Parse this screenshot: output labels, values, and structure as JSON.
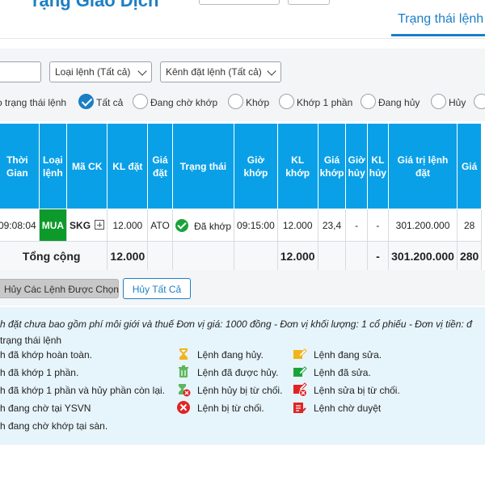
{
  "header": {
    "title_fragment": "rạng Giao Dịch",
    "status_tab": "Trạng thái lệnh"
  },
  "filters": {
    "order_type": "Loại lệnh (Tất cả)",
    "channel": "Kênh đặt lệnh (Tất cả)",
    "status_label": "o trạng thái lệnh",
    "status_options": [
      {
        "label": "Tất cả",
        "checked": true
      },
      {
        "label": "Đang chờ khớp",
        "checked": false
      },
      {
        "label": "Khớp",
        "checked": false
      },
      {
        "label": "Khớp 1 phần",
        "checked": false
      },
      {
        "label": "Đang hủy",
        "checked": false
      },
      {
        "label": "Hủy",
        "checked": false
      },
      {
        "label": "",
        "checked": false
      }
    ]
  },
  "table": {
    "headers": [
      "Thời Gian",
      "Loại lệnh",
      "Mã CK",
      "KL đặt",
      "Giá đặt",
      "Trạng thái",
      "Giờ khớp",
      "KL khớp",
      "Giá khớp",
      "Giờ hủy",
      "KL hủy",
      "Giá trị lệnh đặt",
      "Giá"
    ],
    "row": {
      "time": "09:08:04",
      "side": "MUA",
      "symbol": "SKG",
      "qty": "12.000",
      "price": "ATO",
      "status": "Đã khớp",
      "match_time": "09:15:00",
      "match_qty": "12.000",
      "match_price": "23,4",
      "cancel_time": "-",
      "cancel_qty": "-",
      "order_value": "301.200.000",
      "last_frag": "28"
    },
    "total": {
      "label": "Tổng cộng",
      "qty": "12.000",
      "match_qty": "12.000",
      "cancel_qty": "-",
      "order_value": "301.200.000",
      "last_frag": "280"
    }
  },
  "actions": {
    "cancel_selected": "Hủy Các Lệnh Được Chọn",
    "cancel_all": "Hủy Tất Cả"
  },
  "notes": {
    "text": "h đặt chưa bao gồm phí môi giới và thuế  Đơn vị giá: 1000 đồng - Đơn vị khối lượng: 1 cổ phiếu - Đơn vị tiền: đ",
    "legend_title": "trạng thái lệnh",
    "legend": {
      "col1": [
        "h đã khớp hoàn toàn.",
        "h đã khớp 1 phần.",
        "h đã khớp 1 phần và hủy phần còn lại.",
        "h đang chờ tại YSVN",
        "h đang chờ khớp tại sàn."
      ],
      "col2": [
        "Lệnh đang hủy.",
        "Lệnh đã được hủy.",
        "Lệnh hủy bị từ chối.",
        "Lệnh bị từ chối."
      ],
      "col3": [
        "Lệnh đang sửa.",
        "Lệnh đã sửa.",
        "Lệnh sửa bị từ chối.",
        "Lệnh chờ duyệt"
      ]
    }
  },
  "colors": {
    "accent": "#1b7fc4",
    "header_bg": "#0aa0e8",
    "buy": "#0e9a2b",
    "matched": "#1aa33a",
    "legend_bg": "#e6f4fb"
  }
}
